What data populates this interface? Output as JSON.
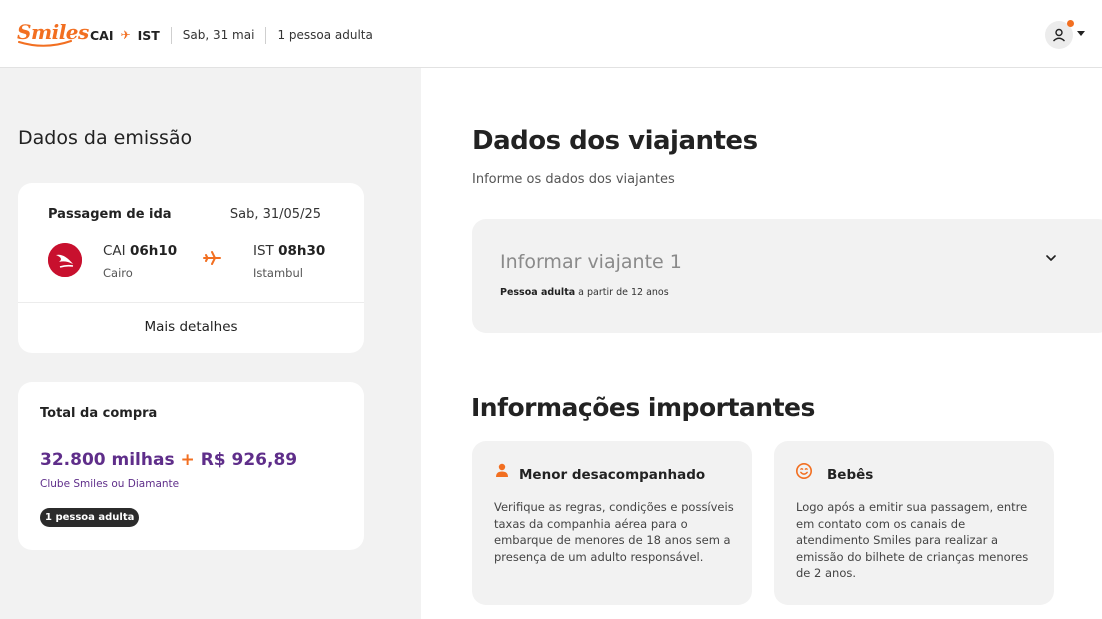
{
  "header": {
    "logo_text": "Smiles",
    "origin": "CAI",
    "destination": "IST",
    "date": "Sab, 31 mai",
    "passengers": "1 pessoa adulta",
    "brand_color": "#f26f21"
  },
  "left": {
    "title": "Dados da emissão",
    "flight_card": {
      "title": "Passagem de ida",
      "date": "Sab, 31/05/25",
      "departure": {
        "code": "CAI",
        "time": "06h10",
        "city": "Cairo"
      },
      "arrival": {
        "code": "IST",
        "time": "08h30",
        "city": "Istambul"
      },
      "more_details": "Mais detalhes",
      "airline_color": "#c8102e"
    },
    "total_card": {
      "title": "Total da compra",
      "miles": "32.800 milhas",
      "plus": "+",
      "money": "R$ 926,89",
      "club": "Clube Smiles ou Diamante",
      "badge": "1 pessoa adulta",
      "price_color": "#5f2e8a"
    }
  },
  "right": {
    "title": "Dados dos viajantes",
    "subtitle": "Informe os dados dos viajantes",
    "traveler": {
      "title": "Informar viajante 1",
      "type_bold": "Pessoa adulta",
      "type_rest": " a partir de 12 anos"
    },
    "info_title": "Informações importantes",
    "info_cards": [
      {
        "icon": "person-icon",
        "title": "Menor desacompanhado",
        "text": "Verifique as regras, condições e possíveis taxas da companhia aérea para o embarque de menores de 18 anos sem a presença de um adulto responsável."
      },
      {
        "icon": "baby-face-icon",
        "title": "Bebês",
        "text": "Logo após a emitir sua passagem, entre em contato com os canais de atendimento Smiles para realizar a emissão do bilhete de crianças menores de 2 anos."
      }
    ]
  }
}
